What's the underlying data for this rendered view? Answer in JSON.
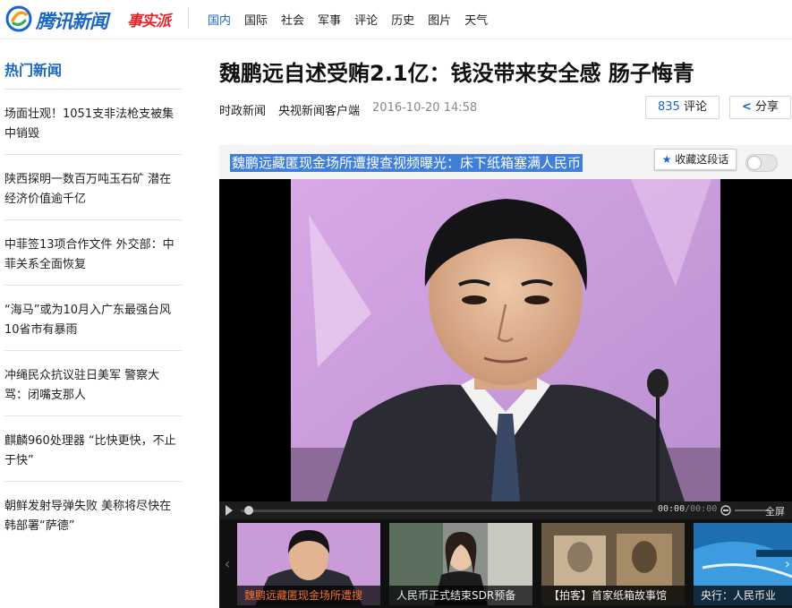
{
  "header": {
    "brand": "腾讯新闻",
    "brand_badge": "事实派",
    "nav": [
      "国内",
      "国际",
      "社会",
      "军事",
      "评论",
      "历史",
      "图片",
      "天气"
    ]
  },
  "sidebar": {
    "title": "热门新闻",
    "items": [
      "场面壮观！1051支非法枪支被集中销毁",
      "陕西探明一数百万吨玉石矿 潜在经济价值逾千亿",
      "中菲签13项合作文件 外交部：中菲关系全面恢复",
      "“海马”或为10月入广东最强台风 10省市有暴雨",
      "冲绳民众抗议驻日美军 警察大骂：闭嘴支那人",
      "麒麟960处理器 “比快更快，不止于快”",
      "朝鲜发射导弹失败 美称将尽快在韩部署“萨德”"
    ]
  },
  "article": {
    "title": "魏鹏远自述受贿2.1亿：钱没带来安全感 肠子悔青",
    "category": "时政新闻",
    "source": "央视新闻客户端",
    "date": "2016-10-20 14:58",
    "comment_count": "835",
    "comment_label": "评论",
    "share_label": "分享"
  },
  "video": {
    "title": "魏鹏远藏匿现金场所遭搜查视频曝光：床下纸箱塞满人民币",
    "favorite_label": "收藏这段话",
    "time_current": "00:00",
    "time_total": "/00:00",
    "fullscreen_label": "全屏",
    "progress": 0.0
  },
  "thumbnails": [
    {
      "caption": "魏鹏远藏匿现金场所遭搜",
      "active": true
    },
    {
      "caption": "人民币正式结束SDR预备",
      "active": false
    },
    {
      "caption": "【拍客】首家纸箱故事馆",
      "active": false
    },
    {
      "caption": "央行：人民币业",
      "active": false
    }
  ],
  "colors": {
    "accent": "#1a67c3",
    "badge_red": "#e2262b",
    "highlight": "#3f7fd8",
    "active_caption": "#f2722e"
  }
}
